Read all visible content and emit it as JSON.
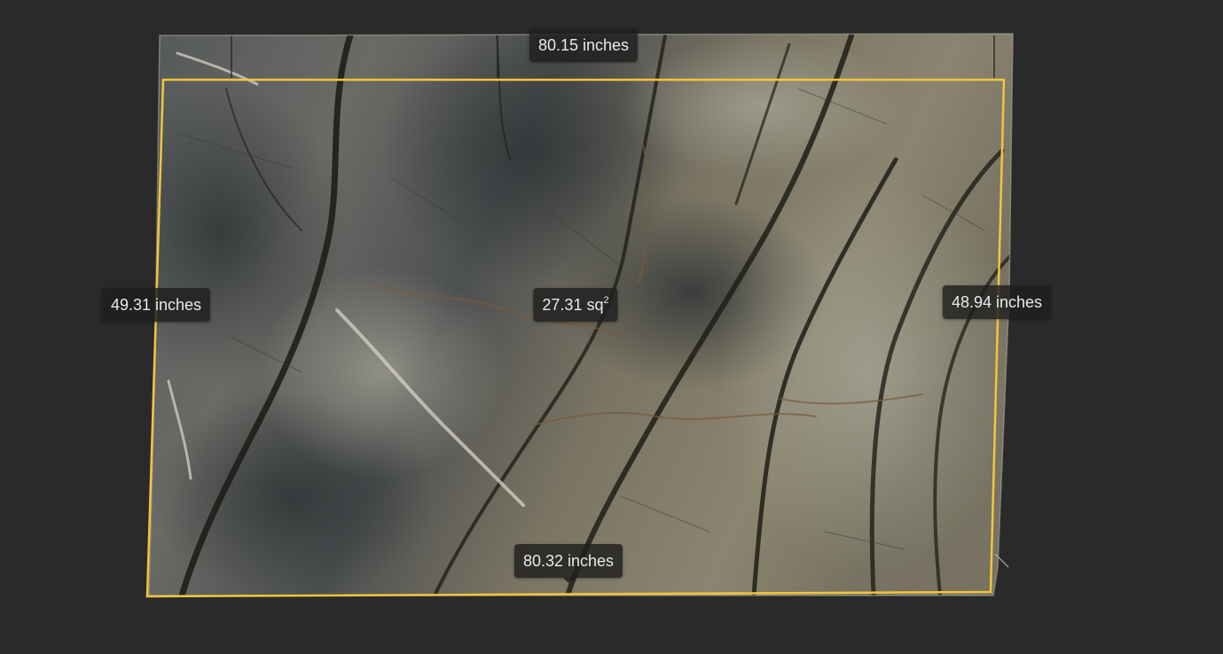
{
  "measurements": {
    "top_edge": "80.15 inches",
    "bottom_edge": "80.32 inches",
    "left_edge": "49.31 inches",
    "right_edge": "48.94 inches",
    "area_value": "27.31 sq",
    "area_superscript": "2"
  },
  "colors": {
    "background": "#2a2a2a",
    "selection_outline": "#f2c53d",
    "label_background": "#1e1e1e",
    "label_text": "#e9e9e9"
  }
}
